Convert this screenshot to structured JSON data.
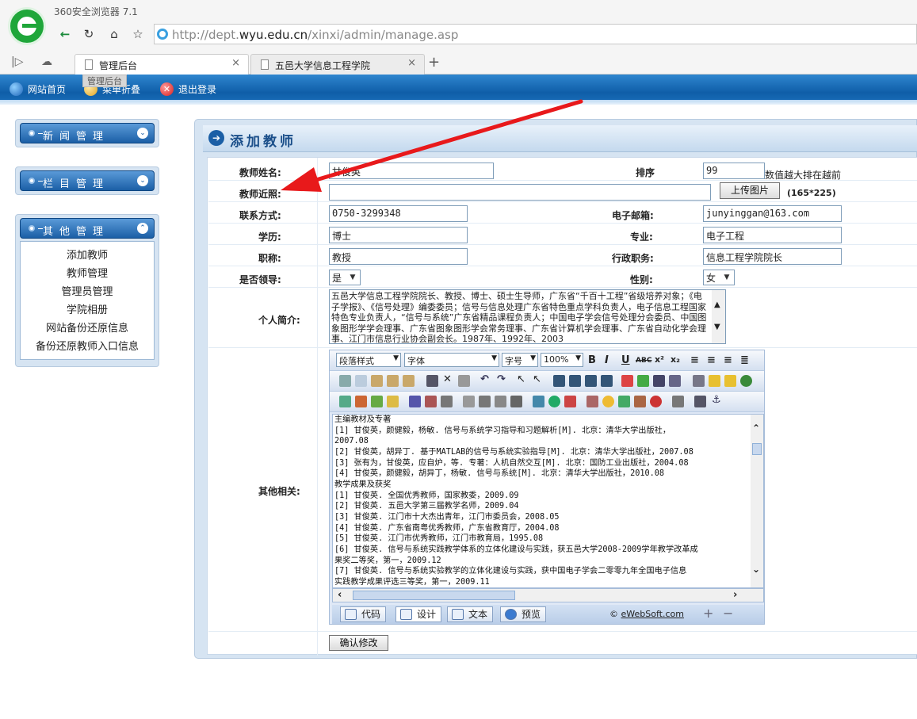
{
  "browser": {
    "app_title": "360安全浏览器 7.1",
    "url_prefix": "http://dept.",
    "url_host": "wyu.edu.cn",
    "url_path": "/xinxi/admin/manage.asp",
    "tabs": [
      {
        "label": "管理后台",
        "active": true
      },
      {
        "label": "五邑大学信息工程学院",
        "active": false
      }
    ],
    "tooltip": "管理后台"
  },
  "topbar": {
    "home": "网站首页",
    "collapse_menu": "菜单折叠",
    "logout": "退出登录"
  },
  "sidebar": {
    "groups": [
      {
        "title": "新闻管理",
        "toggle": "⌄",
        "expanded": false
      },
      {
        "title": "栏目管理",
        "toggle": "⌄",
        "expanded": false
      },
      {
        "title": "其他管理",
        "toggle": "⌃",
        "expanded": true
      }
    ],
    "links": [
      "添加教师",
      "教师管理",
      "管理员管理",
      "学院相册",
      "网站备份还原信息",
      "备份还原教师入口信息"
    ]
  },
  "panel": {
    "title": "添加教师"
  },
  "form": {
    "name_label": "教师姓名:",
    "name_value": "甘俊英",
    "order_label": "排序",
    "order_value": "99",
    "order_note": "数值越大排在越前",
    "photo_label": "教师近照:",
    "photo_value": "",
    "upload_button": "上传图片",
    "photo_size": "(165*225)",
    "contact_label": "联系方式:",
    "contact_value": "0750-3299348",
    "email_label": "电子邮箱:",
    "email_value": "junyinggan@163.com",
    "education_label": "学历:",
    "education_value": "博士",
    "major_label": "专业:",
    "major_value": "电子工程",
    "title_label": "职称:",
    "title_value": "教授",
    "position_label": "行政职务:",
    "position_value": "信息工程学院院长",
    "leader_label": "是否领导:",
    "leader_value": "是",
    "gender_label": "性别:",
    "gender_value": "女",
    "intro_label": "个人简介:",
    "intro_text": "五邑大学信息工程学院院长、教授、博士、硕士生导师，广东省“千百十工程”省级培养对象；《电子学报》、《信号处理》编委委员；信号与信息处理广东省特色重点学科负责人，电子信息工程国家特色专业负责人，“信号与系统”广东省精品课程负责人；中国电子学会信号处理分会委员、中国图象图形学学会理事、广东省图象图形学会常务理事、广东省计算机学会理事、广东省自动化学会理事、江门市信息行业协会副会长。1987年、1992年、2003",
    "other_label": "其他相关:",
    "submit_button": "确认修改"
  },
  "editor": {
    "format_select": "段落样式",
    "font_select": "字体",
    "size_select": "字号",
    "zoom_select": "100%",
    "bold": "B",
    "italic": "I",
    "underline": "U",
    "strike": "ABC",
    "content_lines": [
      "主编教材及专著",
      "[1]  甘俊英，颜健毅，杨敏. 信号与系统学习指导和习题解析[M]. 北京：清华大学出版社，",
      "2007.08",
      "[2]  甘俊英，胡异丁. 基于MATLAB的信号与系统实验指导[M]. 北京：清华大学出版社，2007.08",
      "[3]  张有为，甘俊英，应自炉，等. 专著：人机自然交互[M]. 北京：国防工业出版社，2004.08",
      "[4]  甘俊英，颜健毅，胡异丁，杨敏. 信号与系统[M]. 北京：清华大学出版社，2010.08",
      "教学成果及获奖",
      "[1]  甘俊英. 全国优秀教师，国家教委，2009.09",
      "[2]  甘俊英. 五邑大学第三届教学名师，2009.04",
      "[3]  甘俊英. 江门市十大杰出青年，江门市委员会，2008.05",
      "[4]  甘俊英. 广东省南粤优秀教师，广东省教育厅，2004.08",
      "[5]  甘俊英. 江门市优秀教师，江门市教育局，1995.08",
      "[6]  甘俊英. 信号与系统实践教学体系的立体化建设与实践，获五邑大学2008-2009学年教学改革成",
      "果奖二等奖，第一，2009.12",
      "[7]  甘俊英. 信号与系统实验教学的立体化建设与实践，获中国电子学会二零零九年全国电子信息",
      "实践教学成果评选三等奖，第一，2009.11"
    ],
    "modes": [
      "代码",
      "设计",
      "文本",
      "预览"
    ],
    "copyright_symbol": "©",
    "copyright_link": "eWebSoft.com",
    "zoom_in": "+",
    "zoom_out": "−"
  }
}
